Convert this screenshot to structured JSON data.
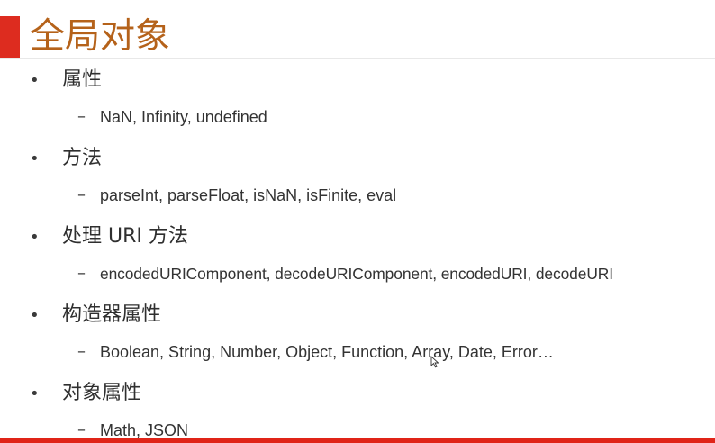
{
  "slide": {
    "title": "全局对象",
    "bullets": [
      {
        "label": "属性",
        "sub": "NaN, Infinity, undefined"
      },
      {
        "label": "方法",
        "sub": "parseInt, parseFloat, isNaN, isFinite, eval"
      },
      {
        "label": "处理 URI 方法",
        "sub": "encodedURIComponent, decodeURIComponent, encodedURI, decodeURI"
      },
      {
        "label": "构造器属性",
        "sub": "Boolean, String, Number, Object, Function, Array, Date, Error…"
      },
      {
        "label": "对象属性",
        "sub": "Math, JSON"
      }
    ],
    "bullet_glyph": "•",
    "sub_glyph": "–"
  },
  "colors": {
    "title_text": "#b5621a",
    "accent_red": "#dd2c1f",
    "bottom_bar": "#e02418",
    "body_text": "#2f2f2f"
  },
  "icons": {
    "cursor": "mouse-pointer-icon"
  }
}
